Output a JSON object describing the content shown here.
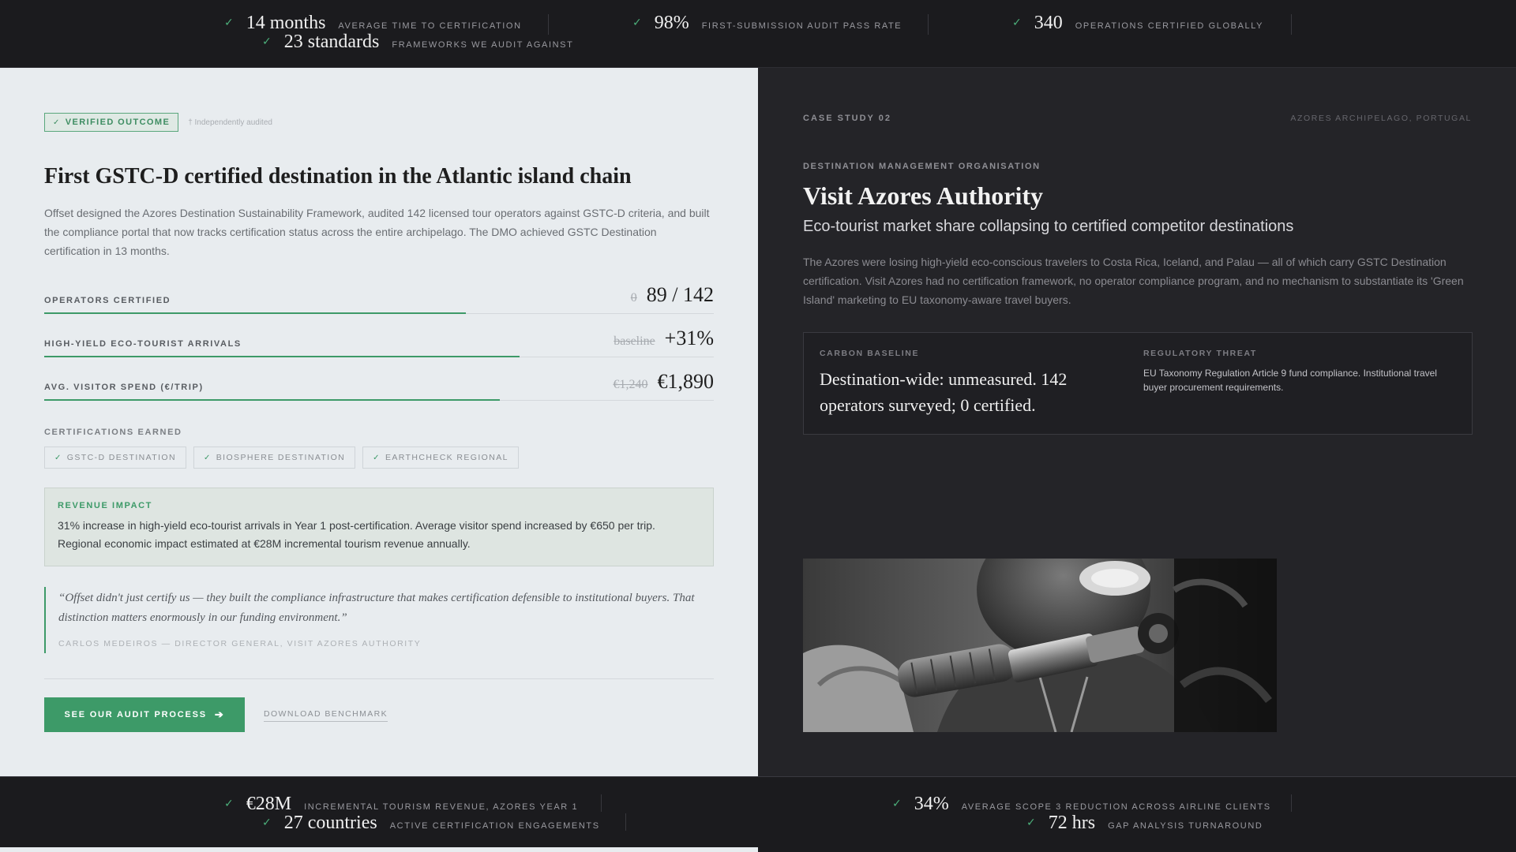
{
  "top_stats": [
    {
      "value": "14 months",
      "label": "AVERAGE TIME TO CERTIFICATION"
    },
    {
      "value": "98%",
      "label": "FIRST-SUBMISSION AUDIT PASS RATE"
    },
    {
      "value": "340",
      "label": "OPERATIONS CERTIFIED GLOBALLY"
    },
    {
      "value": "23 standards",
      "label": "FRAMEWORKS WE AUDIT AGAINST"
    }
  ],
  "left": {
    "badge": "VERIFIED OUTCOME",
    "badge_note": "† Independently audited",
    "title": "First GSTC-D certified destination in the Atlantic island chain",
    "description": "Offset designed the Azores Destination Sustainability Framework, audited 142 licensed tour operators against GSTC-D criteria, and built the compliance portal that now tracks certification status across the entire archipelago. The DMO achieved GSTC Destination certification in 13 months.",
    "metrics": [
      {
        "label": "OPERATORS CERTIFIED",
        "old": "0",
        "new": "89 / 142",
        "progress": 0.63
      },
      {
        "label": "HIGH-YIELD ECO-TOURIST ARRIVALS",
        "old": "baseline",
        "new": "+31%",
        "progress": 0.71
      },
      {
        "label": "AVG. VISITOR SPEND (€/TRIP)",
        "old": "€1,240",
        "new": "€1,890",
        "progress": 0.68
      }
    ],
    "certifications_heading": "CERTIFICATIONS EARNED",
    "certifications": [
      "GSTC-D DESTINATION",
      "BIOSPHERE DESTINATION",
      "EARTHCHECK REGIONAL"
    ],
    "revenue": {
      "title": "REVENUE IMPACT",
      "text": "31% increase in high-yield eco-tourist arrivals in Year 1 post-certification. Average visitor spend increased by €650 per trip. Regional economic impact estimated at €28M incremental tourism revenue annually."
    },
    "quote": {
      "text": "“Offset didn't just certify us — they built the compliance infrastructure that makes certification defensible to institutional buyers. That distinction matters enormously in our funding environment.”",
      "attribution": "CARLOS MEDEIROS — DIRECTOR GENERAL, VISIT AZORES AUTHORITY"
    },
    "cta_label": "SEE OUR AUDIT PROCESS",
    "download_label": "DOWNLOAD BENCHMARK"
  },
  "right": {
    "case_label": "CASE STUDY 02",
    "location": "AZORES ARCHIPELAGO, PORTUGAL",
    "org_type": "DESTINATION MANAGEMENT ORGANISATION",
    "title": "Visit Azores Authority",
    "subtitle": "Eco-tourist market share collapsing to certified competitor destinations",
    "description": "The Azores were losing high-yield eco-conscious travelers to Costa Rica, Iceland, and Palau — all of which carry GSTC Destination certification. Visit Azores had no certification framework, no operator compliance program, and no mechanism to substantiate its 'Green Island' marketing to EU taxonomy-aware travel buyers.",
    "carbon": {
      "label": "CARBON BASELINE",
      "value": "Destination-wide: unmeasured. 142 operators surveyed; 0 certified."
    },
    "regulatory": {
      "label": "REGULATORY THREAT",
      "value": "EU Taxonomy Regulation Article 9 fund compliance. Institutional travel buyer procurement requirements."
    }
  },
  "bottom_stats": [
    {
      "value": "€28M",
      "label": "INCREMENTAL TOURISM REVENUE, AZORES YEAR 1"
    },
    {
      "value": "34%",
      "label": "AVERAGE SCOPE 3 REDUCTION ACROSS AIRLINE CLIENTS"
    },
    {
      "value": "27 countries",
      "label": "ACTIVE CERTIFICATION ENGAGEMENTS"
    },
    {
      "value": "72 hrs",
      "label": "GAP ANALYSIS TURNAROUND"
    }
  ],
  "colors": {
    "accent": "#3d9a68",
    "check": "#4caf7a",
    "dark_bg": "#1c1c1f",
    "light_bg": "#e8ecef"
  }
}
